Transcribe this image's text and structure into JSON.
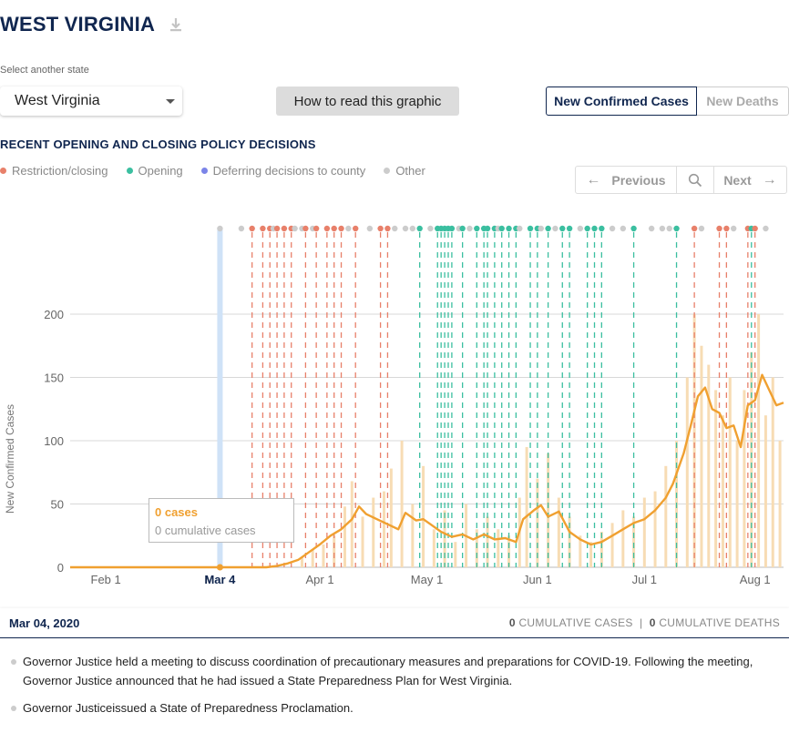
{
  "header": {
    "state_title": "WEST VIRGINIA",
    "download_icon": "download-icon"
  },
  "state_select": {
    "label": "Select another state",
    "value": "West Virginia"
  },
  "how_to_read": "How to read this graphic",
  "toggle": {
    "active": "New Confirmed Cases",
    "inactive": "New Deaths"
  },
  "policy": {
    "heading": "RECENT OPENING AND CLOSING POLICY DECISIONS",
    "legend": [
      {
        "label": "Restriction/closing",
        "color": "#e8806a"
      },
      {
        "label": "Opening",
        "color": "#3bbfa0"
      },
      {
        "label": "Deferring decisions to county",
        "color": "#7b84e8"
      },
      {
        "label": "Other",
        "color": "#cccccc"
      }
    ]
  },
  "nav": {
    "previous": "Previous",
    "next": "Next",
    "search_icon": "search-icon"
  },
  "tooltip": {
    "cases": "0 cases",
    "cumulative": "0 cumulative cases"
  },
  "date_bar": {
    "date": "Mar 04, 2020",
    "cum_cases_value": "0",
    "cum_cases_label": "CUMULATIVE CASES",
    "separator": "|",
    "cum_deaths_value": "0",
    "cum_deaths_label": "CUMULATIVE DEATHS"
  },
  "events": [
    "Governor Justice held a meeting to discuss coordination of precautionary measures and preparations for COVID-19. Following the meeting, Governor Justice announced that he had issued a State Preparedness Plan for West Virginia.",
    "Governor Justiceissued a State of Preparedness Proclamation."
  ],
  "chart_data": {
    "type": "line",
    "ylabel": "New Confirmed Cases",
    "yticks": [
      0,
      50,
      100,
      150,
      200
    ],
    "ylim": [
      0,
      220
    ],
    "xlim": [
      "2020-01-22",
      "2020-08-09"
    ],
    "xticks": [
      {
        "date": "2020-02-01",
        "label": "Feb 1"
      },
      {
        "date": "2020-03-01",
        "label": "M"
      },
      {
        "date": "2020-04-01",
        "label": "Apr 1"
      },
      {
        "date": "2020-05-01",
        "label": "May 1"
      },
      {
        "date": "2020-06-01",
        "label": "Jun 1"
      },
      {
        "date": "2020-07-01",
        "label": "Jul 1"
      },
      {
        "date": "2020-08-01",
        "label": "Aug 1"
      }
    ],
    "selected": {
      "date": "2020-03-04",
      "label": "Mar 4",
      "value": 0
    },
    "grid": true,
    "series": [
      {
        "kind": "7-day average line",
        "color": "#f0a030",
        "points": [
          [
            "2020-01-22",
            0
          ],
          [
            "2020-03-04",
            0
          ],
          [
            "2020-03-17",
            0
          ],
          [
            "2020-03-20",
            1
          ],
          [
            "2020-03-23",
            3
          ],
          [
            "2020-03-26",
            6
          ],
          [
            "2020-03-29",
            12
          ],
          [
            "2020-04-01",
            18
          ],
          [
            "2020-04-04",
            25
          ],
          [
            "2020-04-07",
            30
          ],
          [
            "2020-04-10",
            38
          ],
          [
            "2020-04-12",
            48
          ],
          [
            "2020-04-14",
            42
          ],
          [
            "2020-04-17",
            38
          ],
          [
            "2020-04-20",
            34
          ],
          [
            "2020-04-23",
            30
          ],
          [
            "2020-04-25",
            43
          ],
          [
            "2020-04-28",
            37
          ],
          [
            "2020-04-30",
            38
          ],
          [
            "2020-05-02",
            34
          ],
          [
            "2020-05-05",
            28
          ],
          [
            "2020-05-08",
            24
          ],
          [
            "2020-05-11",
            26
          ],
          [
            "2020-05-14",
            22
          ],
          [
            "2020-05-17",
            26
          ],
          [
            "2020-05-20",
            22
          ],
          [
            "2020-05-23",
            23
          ],
          [
            "2020-05-26",
            20
          ],
          [
            "2020-05-28",
            38
          ],
          [
            "2020-05-31",
            45
          ],
          [
            "2020-06-02",
            49
          ],
          [
            "2020-06-04",
            40
          ],
          [
            "2020-06-07",
            44
          ],
          [
            "2020-06-10",
            28
          ],
          [
            "2020-06-13",
            22
          ],
          [
            "2020-06-16",
            18
          ],
          [
            "2020-06-19",
            20
          ],
          [
            "2020-06-22",
            25
          ],
          [
            "2020-06-25",
            30
          ],
          [
            "2020-06-28",
            35
          ],
          [
            "2020-07-01",
            38
          ],
          [
            "2020-07-04",
            45
          ],
          [
            "2020-07-07",
            55
          ],
          [
            "2020-07-09",
            66
          ],
          [
            "2020-07-12",
            90
          ],
          [
            "2020-07-14",
            112
          ],
          [
            "2020-07-16",
            135
          ],
          [
            "2020-07-18",
            142
          ],
          [
            "2020-07-20",
            125
          ],
          [
            "2020-07-22",
            122
          ],
          [
            "2020-07-24",
            110
          ],
          [
            "2020-07-26",
            112
          ],
          [
            "2020-07-28",
            95
          ],
          [
            "2020-07-30",
            128
          ],
          [
            "2020-08-01",
            132
          ],
          [
            "2020-08-03",
            152
          ],
          [
            "2020-08-05",
            140
          ],
          [
            "2020-08-07",
            128
          ],
          [
            "2020-08-09",
            130
          ]
        ]
      },
      {
        "kind": "daily new cases bars",
        "color": "#f7dcb4",
        "points": [
          [
            "2020-03-27",
            8
          ],
          [
            "2020-03-30",
            14
          ],
          [
            "2020-04-02",
            18
          ],
          [
            "2020-04-05",
            25
          ],
          [
            "2020-04-08",
            48
          ],
          [
            "2020-04-10",
            68
          ],
          [
            "2020-04-13",
            40
          ],
          [
            "2020-04-16",
            55
          ],
          [
            "2020-04-19",
            60
          ],
          [
            "2020-04-21",
            78
          ],
          [
            "2020-04-24",
            100
          ],
          [
            "2020-04-27",
            50
          ],
          [
            "2020-04-30",
            80
          ],
          [
            "2020-05-03",
            30
          ],
          [
            "2020-05-06",
            45
          ],
          [
            "2020-05-09",
            20
          ],
          [
            "2020-05-12",
            50
          ],
          [
            "2020-05-15",
            30
          ],
          [
            "2020-05-18",
            40
          ],
          [
            "2020-05-21",
            30
          ],
          [
            "2020-05-24",
            25
          ],
          [
            "2020-05-27",
            55
          ],
          [
            "2020-05-29",
            95
          ],
          [
            "2020-06-01",
            70
          ],
          [
            "2020-06-04",
            90
          ],
          [
            "2020-06-07",
            55
          ],
          [
            "2020-06-10",
            40
          ],
          [
            "2020-06-13",
            25
          ],
          [
            "2020-06-16",
            20
          ],
          [
            "2020-06-19",
            28
          ],
          [
            "2020-06-22",
            35
          ],
          [
            "2020-06-25",
            45
          ],
          [
            "2020-06-28",
            40
          ],
          [
            "2020-07-01",
            55
          ],
          [
            "2020-07-04",
            60
          ],
          [
            "2020-07-07",
            80
          ],
          [
            "2020-07-10",
            100
          ],
          [
            "2020-07-13",
            150
          ],
          [
            "2020-07-15",
            200
          ],
          [
            "2020-07-17",
            175
          ],
          [
            "2020-07-19",
            160
          ],
          [
            "2020-07-21",
            140
          ],
          [
            "2020-07-23",
            120
          ],
          [
            "2020-07-25",
            150
          ],
          [
            "2020-07-27",
            100
          ],
          [
            "2020-07-29",
            140
          ],
          [
            "2020-07-31",
            170
          ],
          [
            "2020-08-02",
            200
          ],
          [
            "2020-08-04",
            120
          ],
          [
            "2020-08-06",
            150
          ],
          [
            "2020-08-08",
            100
          ]
        ]
      }
    ],
    "policy_events": [
      {
        "date": "2020-03-04",
        "type": "Other"
      },
      {
        "date": "2020-03-10",
        "type": "Other"
      },
      {
        "date": "2020-03-13",
        "type": "Restriction/closing"
      },
      {
        "date": "2020-03-16",
        "type": "Restriction/closing"
      },
      {
        "date": "2020-03-18",
        "type": "Restriction/closing"
      },
      {
        "date": "2020-03-19",
        "type": "Other"
      },
      {
        "date": "2020-03-20",
        "type": "Restriction/closing"
      },
      {
        "date": "2020-03-22",
        "type": "Restriction/closing"
      },
      {
        "date": "2020-03-24",
        "type": "Restriction/closing"
      },
      {
        "date": "2020-03-25",
        "type": "Other"
      },
      {
        "date": "2020-03-27",
        "type": "Other"
      },
      {
        "date": "2020-03-28",
        "type": "Restriction/closing"
      },
      {
        "date": "2020-03-30",
        "type": "Other"
      },
      {
        "date": "2020-03-31",
        "type": "Restriction/closing"
      },
      {
        "date": "2020-04-03",
        "type": "Restriction/closing"
      },
      {
        "date": "2020-04-05",
        "type": "Restriction/closing"
      },
      {
        "date": "2020-04-07",
        "type": "Restriction/closing"
      },
      {
        "date": "2020-04-09",
        "type": "Other"
      },
      {
        "date": "2020-04-11",
        "type": "Restriction/closing"
      },
      {
        "date": "2020-04-15",
        "type": "Other"
      },
      {
        "date": "2020-04-18",
        "type": "Restriction/closing"
      },
      {
        "date": "2020-04-20",
        "type": "Restriction/closing"
      },
      {
        "date": "2020-04-22",
        "type": "Other"
      },
      {
        "date": "2020-04-25",
        "type": "Other"
      },
      {
        "date": "2020-04-27",
        "type": "Other"
      },
      {
        "date": "2020-04-29",
        "type": "Opening"
      },
      {
        "date": "2020-05-02",
        "type": "Other"
      },
      {
        "date": "2020-05-04",
        "type": "Opening"
      },
      {
        "date": "2020-05-05",
        "type": "Opening"
      },
      {
        "date": "2020-05-06",
        "type": "Opening"
      },
      {
        "date": "2020-05-07",
        "type": "Opening"
      },
      {
        "date": "2020-05-08",
        "type": "Opening"
      },
      {
        "date": "2020-05-10",
        "type": "Other"
      },
      {
        "date": "2020-05-11",
        "type": "Opening"
      },
      {
        "date": "2020-05-13",
        "type": "Other"
      },
      {
        "date": "2020-05-15",
        "type": "Opening"
      },
      {
        "date": "2020-05-17",
        "type": "Opening"
      },
      {
        "date": "2020-05-18",
        "type": "Opening"
      },
      {
        "date": "2020-05-20",
        "type": "Opening"
      },
      {
        "date": "2020-05-21",
        "type": "Other"
      },
      {
        "date": "2020-05-22",
        "type": "Opening"
      },
      {
        "date": "2020-05-24",
        "type": "Opening"
      },
      {
        "date": "2020-05-26",
        "type": "Opening"
      },
      {
        "date": "2020-05-27",
        "type": "Other"
      },
      {
        "date": "2020-05-30",
        "type": "Opening"
      },
      {
        "date": "2020-06-01",
        "type": "Opening"
      },
      {
        "date": "2020-06-02",
        "type": "Other"
      },
      {
        "date": "2020-06-04",
        "type": "Opening"
      },
      {
        "date": "2020-06-06",
        "type": "Other"
      },
      {
        "date": "2020-06-08",
        "type": "Opening"
      },
      {
        "date": "2020-06-10",
        "type": "Opening"
      },
      {
        "date": "2020-06-13",
        "type": "Other"
      },
      {
        "date": "2020-06-15",
        "type": "Opening"
      },
      {
        "date": "2020-06-17",
        "type": "Opening"
      },
      {
        "date": "2020-06-19",
        "type": "Opening"
      },
      {
        "date": "2020-06-22",
        "type": "Other"
      },
      {
        "date": "2020-06-25",
        "type": "Other"
      },
      {
        "date": "2020-06-28",
        "type": "Opening"
      },
      {
        "date": "2020-07-03",
        "type": "Other"
      },
      {
        "date": "2020-07-06",
        "type": "Other"
      },
      {
        "date": "2020-07-08",
        "type": "Other"
      },
      {
        "date": "2020-07-10",
        "type": "Opening"
      },
      {
        "date": "2020-07-15",
        "type": "Restriction/closing"
      },
      {
        "date": "2020-07-17",
        "type": "Other"
      },
      {
        "date": "2020-07-22",
        "type": "Restriction/closing"
      },
      {
        "date": "2020-07-24",
        "type": "Restriction/closing"
      },
      {
        "date": "2020-07-26",
        "type": "Other"
      },
      {
        "date": "2020-07-30",
        "type": "Restriction/closing"
      },
      {
        "date": "2020-07-31",
        "type": "Opening"
      },
      {
        "date": "2020-08-01",
        "type": "Restriction/closing"
      },
      {
        "date": "2020-08-04",
        "type": "Other"
      }
    ]
  }
}
